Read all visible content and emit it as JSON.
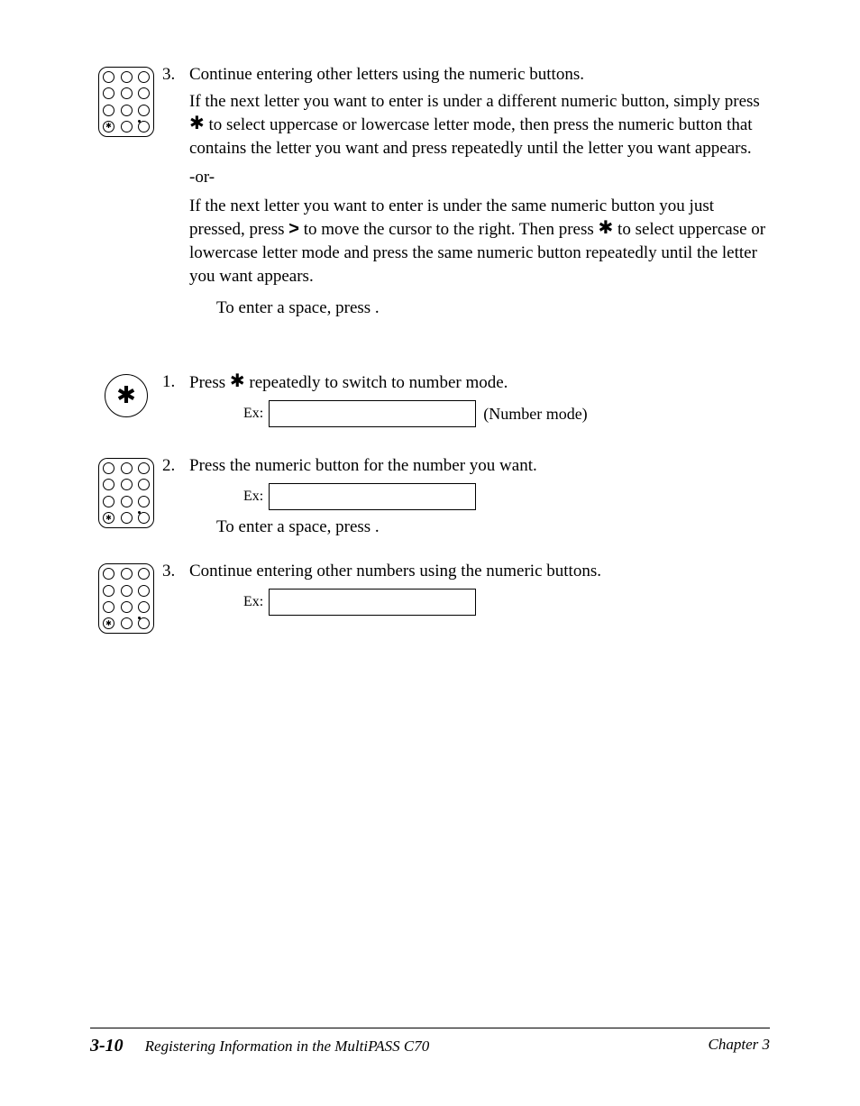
{
  "step3a": {
    "num": "3.",
    "line1": "Continue entering other letters using the numeric buttons.",
    "para1_a": "If the next letter you want to enter is under a different numeric button, simply press ",
    "para1_b": " to select uppercase or lowercase letter mode, then press the numeric button that contains the letter you want and press repeatedly until the letter you want appears.",
    "or": "-or-",
    "para2_a": "If the next letter you want to enter is under the same numeric button you just pressed, press ",
    "para2_b": " to move the cursor to the right. Then press ",
    "para2_c": " to select uppercase or lowercase letter mode and press the same numeric button repeatedly until the letter you want appears.",
    "space": "To enter a space, press         ."
  },
  "step1b": {
    "num": "1.",
    "text_a": "Press ",
    "text_b": " repeatedly to switch to number mode.",
    "ex": "Ex:",
    "mode": "(Number mode)"
  },
  "step2b": {
    "num": "2.",
    "text": "Press the numeric button for the number you want.",
    "ex": "Ex:",
    "space": "To enter a space, press         ."
  },
  "step3b": {
    "num": "3.",
    "text": "Continue entering other numbers using the numeric buttons.",
    "ex": "Ex:"
  },
  "footer": {
    "pagenum": "3-10",
    "title": "Registering Information in the MultiPASS C70",
    "chapter": "Chapter 3"
  },
  "glyphs": {
    "star": "✱",
    "gt": ">"
  }
}
